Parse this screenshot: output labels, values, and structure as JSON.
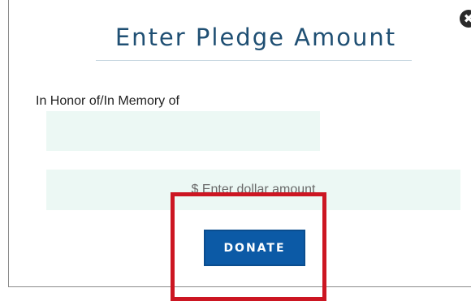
{
  "modal": {
    "title": "Enter Pledge Amount",
    "close_icon": "close-icon",
    "close_glyph": "✖"
  },
  "form": {
    "honor_label": "In Honor of/In Memory of",
    "honor_value": "",
    "amount_value": "",
    "amount_placeholder": "$ Enter dollar amount"
  },
  "actions": {
    "donate_label": "DONATE"
  },
  "colors": {
    "title": "#1f4f73",
    "field_bg": "#ecf8f4",
    "button_bg": "#0c5aa6",
    "highlight": "#cc1622"
  }
}
